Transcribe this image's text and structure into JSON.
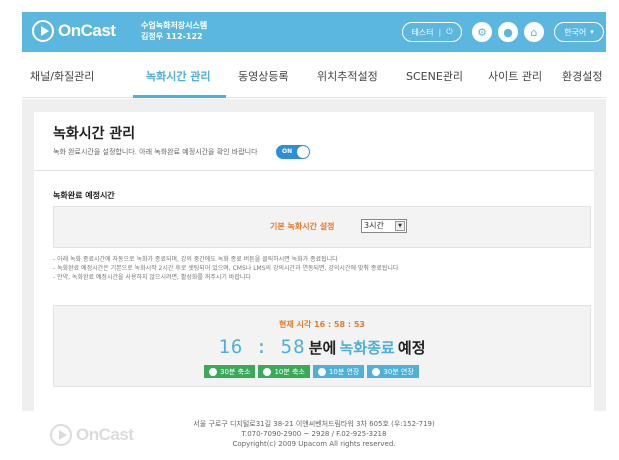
{
  "header": {
    "brand": "OnCast",
    "system_name": "수업녹화저장시스템",
    "room": "김정우 112-122",
    "test_label": "테스터",
    "power_glyph": "⏻",
    "settings_glyph": "⚙",
    "user_glyph": "●",
    "home_glyph": "⌂",
    "lang_label": "한국어",
    "caret": "▾"
  },
  "tabs": [
    "채널/화질관리",
    "녹화시간 관리",
    "동영상등록",
    "위치추적설정",
    "SCENE관리",
    "사이트 관리",
    "환경설정"
  ],
  "active_tab": 1,
  "page": {
    "title": "녹화시간 관리",
    "description": "녹화 완료시간을 설정합니다. 아래 녹화완료 예정시간을 확인 바랍니다",
    "toggle_label": "ON",
    "section_label": "녹화완료 예정시간",
    "setting_label": "기본 녹화시간 설정",
    "setting_value": "3시간",
    "notes": [
      "- 아래 녹화 종료시간에 자동으로 녹화가 종료되며, 강의 중간에도 녹화 종료 버튼을 클릭하시면 녹화가 종료됩니다",
      "- 녹화완료 예정시간은 기본으로 녹화시작 2시간 후로 셋팅되어 있으며, CMS나 LMS의 강의시간과 연동되면, 강의시간에 맞춰 종료됩니다",
      "- 만약, 녹화완료 예정시간을 사용하지 않으시려면, 활성화를 꺼주시기 바랍니다"
    ],
    "current_time_label": "현재 시각 16 : 58 : 53",
    "big_time": "16 : 58",
    "big_text_1": "분에",
    "big_text_2": "녹화종료",
    "big_text_3": "예정",
    "buttons": [
      {
        "label": "30분 축소",
        "color": "#3aaa5a"
      },
      {
        "label": "10분 축소",
        "color": "#3aaa5a"
      },
      {
        "label": "10분 연장",
        "color": "#4eb0d8"
      },
      {
        "label": "30분 연장",
        "color": "#4eb0d8"
      }
    ]
  },
  "footer": {
    "brand": "OnCast",
    "address": "서울 구로구 디지털로31길 38-21 이앤씨벤처드림타워 3차 605호 (우:152-719)",
    "phone": "T.070-7090-2900 ~ 2928 / F.02-925-3218",
    "copyright": "Copyright(c) 2009 Upacom All rights reserved."
  },
  "colors": {
    "header": "#5cb7e0",
    "accent": "#4eb0d8",
    "orange": "#e8792a",
    "green": "#3aaa5a"
  }
}
